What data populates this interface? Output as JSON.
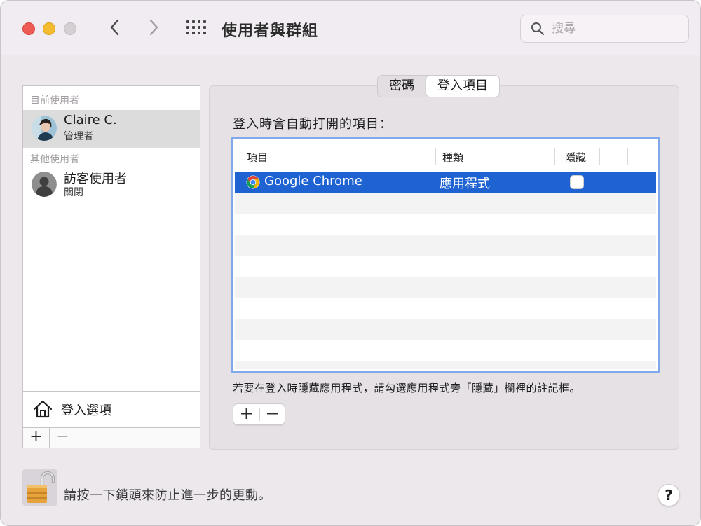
{
  "window": {
    "title": "使用者與群組",
    "search_placeholder": "搜尋"
  },
  "sidebar": {
    "current_users_label": "目前使用者",
    "other_users_label": "其他使用者",
    "users": [
      {
        "name": "Claire C.",
        "role": "管理者",
        "selected": true
      },
      {
        "name": "訪客使用者",
        "role": "關閉",
        "selected": false
      }
    ],
    "login_options_label": "登入選項",
    "add_label": "+",
    "remove_label": "−"
  },
  "tabs": [
    {
      "label": "密碼",
      "active": false
    },
    {
      "label": "登入項目",
      "active": true
    }
  ],
  "main": {
    "heading": "登入時會自動打開的項目：",
    "columns": [
      "項目",
      "種類",
      "隱藏"
    ],
    "items": [
      {
        "name": "Google Chrome",
        "kind": "應用程式",
        "hidden": false,
        "icon": "chrome-icon"
      }
    ],
    "hint": "若要在登入時隱藏應用程式，請勾選應用程式旁「隱藏」欄裡的註記框。",
    "add_label": "+",
    "remove_label": "−"
  },
  "footer": {
    "lock_text": "請按一下鎖頭來防止進一步的更動。",
    "help_label": "?"
  },
  "colors": {
    "accent": "#1f63d3",
    "focus_ring": "#7fa9ea",
    "close": "#ee5b55",
    "minimize": "#f5bb2f"
  }
}
